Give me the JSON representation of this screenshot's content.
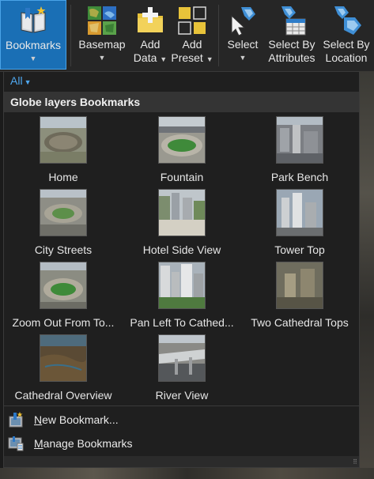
{
  "ribbon": {
    "bookmarks": "Bookmarks",
    "basemap": "Basemap",
    "add_data": [
      "Add",
      "Data"
    ],
    "add_preset": [
      "Add",
      "Preset"
    ],
    "select": "Select",
    "select_by_attributes": [
      "Select By",
      "Attributes"
    ],
    "select_by_location": [
      "Select By",
      "Location"
    ]
  },
  "panel": {
    "filter": "All",
    "gallery_title": "Globe layers Bookmarks",
    "bookmarks": [
      {
        "label": "Home"
      },
      {
        "label": "Fountain"
      },
      {
        "label": "Park Bench"
      },
      {
        "label": "City Streets"
      },
      {
        "label": "Hotel Side View"
      },
      {
        "label": "Tower Top"
      },
      {
        "label": "Zoom Out From To..."
      },
      {
        "label": "Pan Left To Cathed..."
      },
      {
        "label": "Two Cathedral Tops"
      },
      {
        "label": "Cathedral Overview"
      },
      {
        "label": "River View"
      }
    ],
    "menu": {
      "new_bookmark": {
        "mnemonic": "N",
        "rest": "ew Bookmark..."
      },
      "manage_bookmarks": {
        "mnemonic": "M",
        "rest": "anage Bookmarks"
      }
    }
  },
  "colors": {
    "accent": "#1a6fb5",
    "filter_text": "#4fa8ef"
  }
}
